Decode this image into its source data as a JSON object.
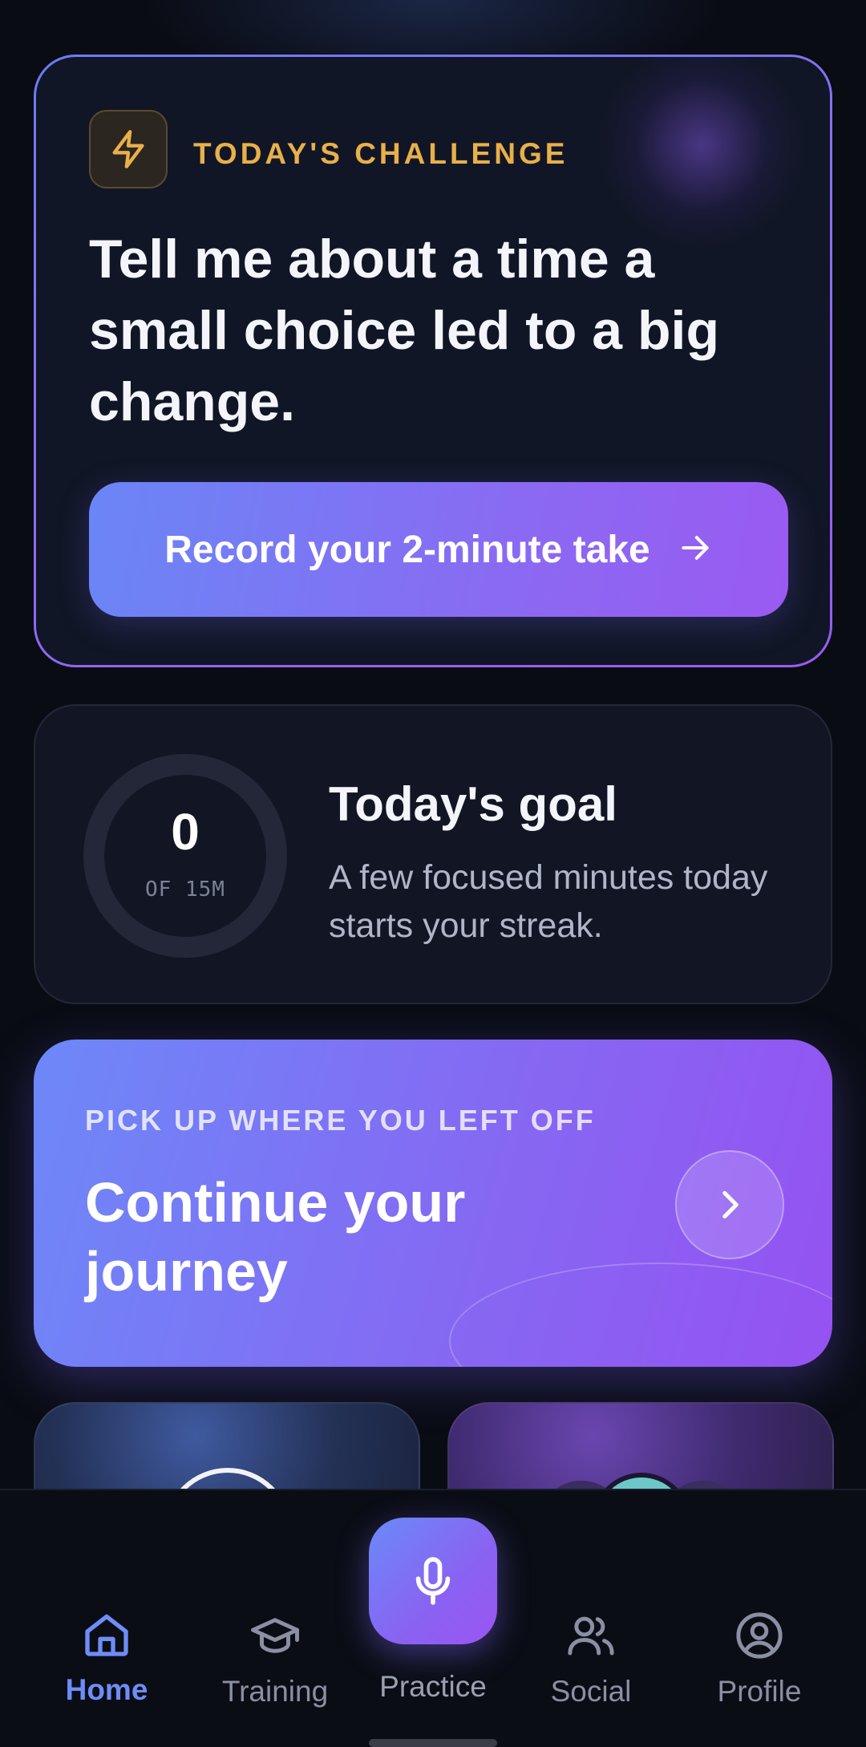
{
  "challenge": {
    "label": "TODAY'S CHALLENGE",
    "icon": "lightning-bolt-icon",
    "question": "Tell me about a time a small choice led to a big change.",
    "record_label": "Record your 2-minute take",
    "accent_color": "#e8b04a"
  },
  "goal": {
    "progress_value": "0",
    "progress_unit": "OF 15M",
    "progress_fraction": 0,
    "title": "Today's goal",
    "description": "A few focused minutes today starts your streak."
  },
  "continue": {
    "eyebrow": "PICK UP WHERE YOU LEFT OFF",
    "title": "Continue your journey"
  },
  "nav": {
    "items": [
      {
        "label": "Home",
        "icon": "home-icon",
        "active": true
      },
      {
        "label": "Training",
        "icon": "graduation-cap-icon",
        "active": false
      },
      {
        "label": "Practice",
        "icon": "microphone-icon",
        "active": false
      },
      {
        "label": "Social",
        "icon": "users-icon",
        "active": false
      },
      {
        "label": "Profile",
        "icon": "user-circle-icon",
        "active": false
      }
    ],
    "active_color": "#6f8df8"
  }
}
